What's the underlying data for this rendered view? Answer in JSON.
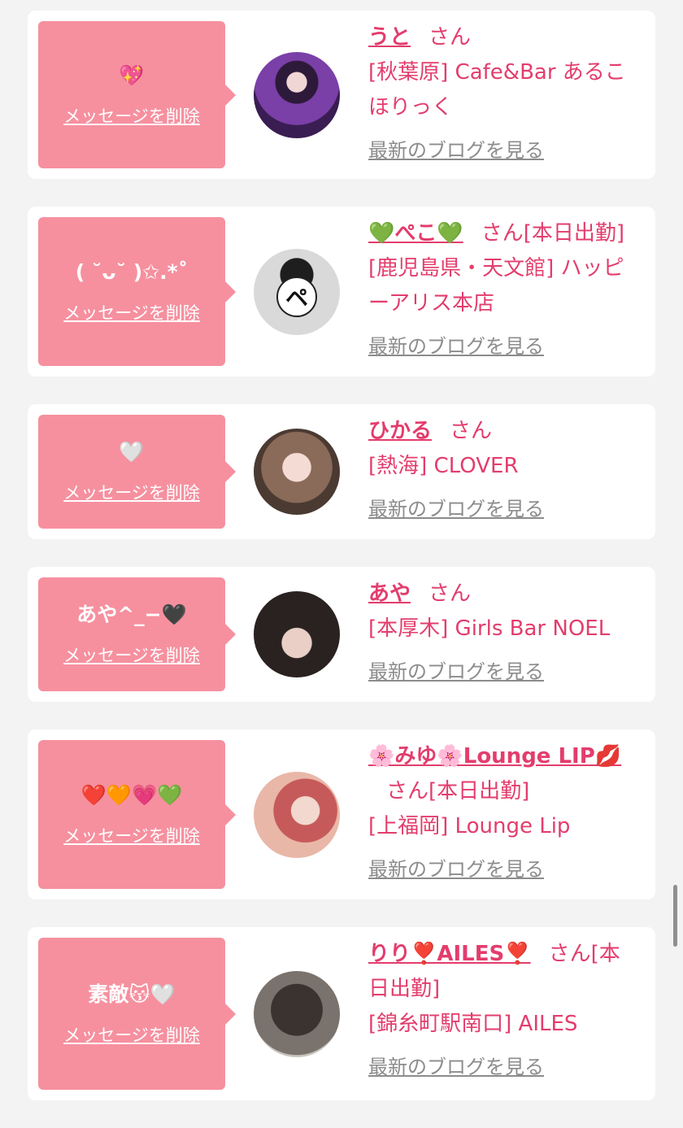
{
  "cards": [
    {
      "message": "💖",
      "delete_label": "メッセージを削除",
      "name": "うと",
      "honorific": "さん",
      "status": "",
      "store": "[秋葉原] Cafe&Bar あるこほりっく",
      "blog_label": "最新のブログを見る"
    },
    {
      "message": "( ˘ᴗ˘ )✩.*˚",
      "delete_label": "メッセージを削除",
      "name": "💚ぺこ💚",
      "honorific": "さん",
      "status": "[本日出勤]",
      "store": "[鹿児島県・天文館] ハッピーアリス本店",
      "blog_label": "最新のブログを見る",
      "avatar_letter": "ペ"
    },
    {
      "message": "🤍",
      "delete_label": "メッセージを削除",
      "name": "ひかる",
      "honorific": "さん",
      "status": "",
      "store": "[熱海] CLOVER",
      "blog_label": "最新のブログを見る"
    },
    {
      "message": "あや^_−🖤",
      "delete_label": "メッセージを削除",
      "name": "あや",
      "honorific": "さん",
      "status": "",
      "store": "[本厚木] Girls Bar NOEL",
      "blog_label": "最新のブログを見る"
    },
    {
      "message": "❤️🧡💗💚",
      "delete_label": "メッセージを削除",
      "name": "🌸みゆ🌸Lounge LIP💋",
      "honorific": "さん",
      "status": "[本日出勤]",
      "store": "[上福岡] Lounge Lip",
      "blog_label": "最新のブログを見る"
    },
    {
      "message": "素敵😽🤍",
      "delete_label": "メッセージを削除",
      "name": "りり❣️AILES❣️",
      "honorific": "さん",
      "status": "[本日出勤]",
      "store": "[錦糸町駅南口] AILES",
      "blog_label": "最新のブログを見る"
    }
  ],
  "colors": {
    "accent_pink": "#f6909f",
    "name_pink": "#e33d6d",
    "link_gray": "#8c8c8c",
    "page_bg": "#f3f3f3"
  }
}
